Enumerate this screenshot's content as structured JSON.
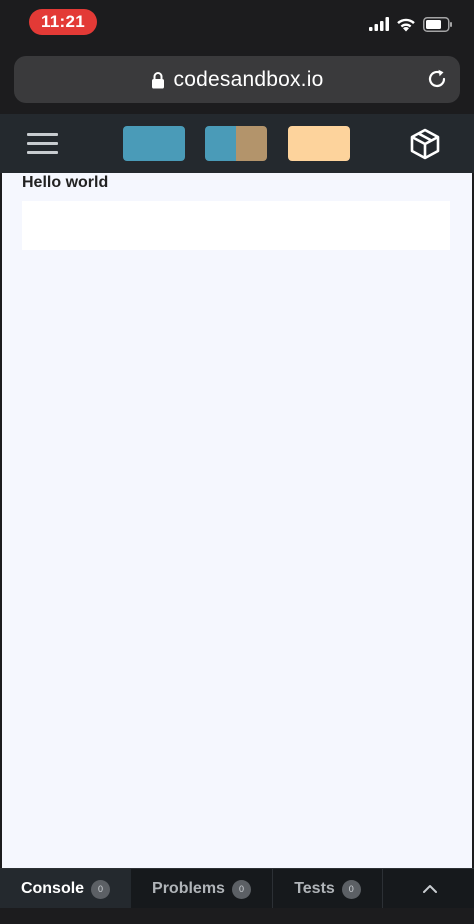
{
  "status_bar": {
    "time": "11:21",
    "time_pill_color": "#e33a36",
    "icons": [
      "signal-icon",
      "wifi-icon",
      "battery-icon"
    ]
  },
  "browser": {
    "url": "codesandbox.io",
    "icons": [
      "lock-icon",
      "reload-icon"
    ]
  },
  "app_header": {
    "icons": [
      "hamburger-menu-icon",
      "codesandbox-cube-icon"
    ],
    "view_colors": {
      "editor": "#4a9bb8",
      "split_left": "#4a9bb8",
      "split_right": "#b3946b",
      "preview": "#fdd39c"
    }
  },
  "preview": {
    "heading": "Hello world"
  },
  "bottom_tabs": [
    {
      "label": "Console",
      "count": "0",
      "active": true
    },
    {
      "label": "Problems",
      "count": "0",
      "active": false
    },
    {
      "label": "Tests",
      "count": "0",
      "active": false
    }
  ]
}
